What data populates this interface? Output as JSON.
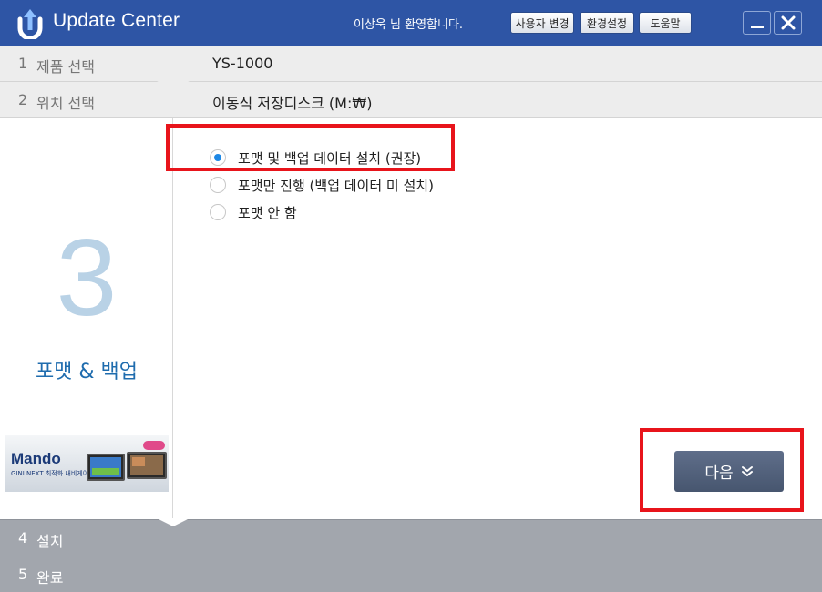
{
  "header": {
    "app_title": "Update Center",
    "welcome": "이상욱  님 환영합니다.",
    "buttons": [
      "사용자 변경",
      "환경설정",
      "도움말"
    ]
  },
  "steps": [
    {
      "num": "1",
      "label": "제품 선택",
      "value": "YS-1000"
    },
    {
      "num": "2",
      "label": "위치 선택",
      "value": "이동식 저장디스크 (M:₩)"
    },
    {
      "num": "4",
      "label": "설치"
    },
    {
      "num": "5",
      "label": "완료"
    }
  ],
  "current_step": {
    "num": "3",
    "title": "포맷 & 백업"
  },
  "banner": {
    "brand": "Mando",
    "sub": "GINI NEXT 최적화 내비게이션"
  },
  "options": [
    {
      "label": "포맷 및 백업 데이터 설치 (권장)",
      "selected": true
    },
    {
      "label": "포맷만 진행 (백업 데이터 미 설치)",
      "selected": false
    },
    {
      "label": "포맷 안 함",
      "selected": false
    }
  ],
  "next_button": {
    "label": "다음"
  },
  "colors": {
    "titlebar": "#2e55a5",
    "accent": "#1f6cae",
    "radio": "#1e88e5",
    "highlight": "#e8141b"
  }
}
